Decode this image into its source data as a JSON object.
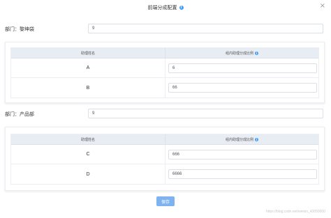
{
  "dialog": {
    "title": "前端分成配置",
    "close_symbol": "×"
  },
  "groups": [
    {
      "label": "部门：黎坤袋",
      "input_value": "9",
      "table": {
        "col1_header": "助理姓名",
        "col2_header": "组内助理分成比例",
        "rows": [
          {
            "name": "A",
            "value": "6"
          },
          {
            "name": "B",
            "value": "66"
          }
        ]
      }
    },
    {
      "label": "部门：产品部",
      "input_value": "9",
      "table": {
        "col1_header": "助理姓名",
        "col2_header": "组内助理分成比例",
        "rows": [
          {
            "name": "C",
            "value": "666"
          },
          {
            "name": "D",
            "value": "6666"
          }
        ]
      }
    }
  ],
  "footer": {
    "save_label": "保存",
    "watermark": "https://blog.csdn.net/weixin_43050000"
  },
  "colors": {
    "accent": "#409eff",
    "save_button": "#7fb3f0",
    "table_header_bg": "#e8ecf3"
  },
  "icons": {
    "title_info": "info-icon",
    "header_info": "info-icon",
    "close": "close-icon"
  }
}
